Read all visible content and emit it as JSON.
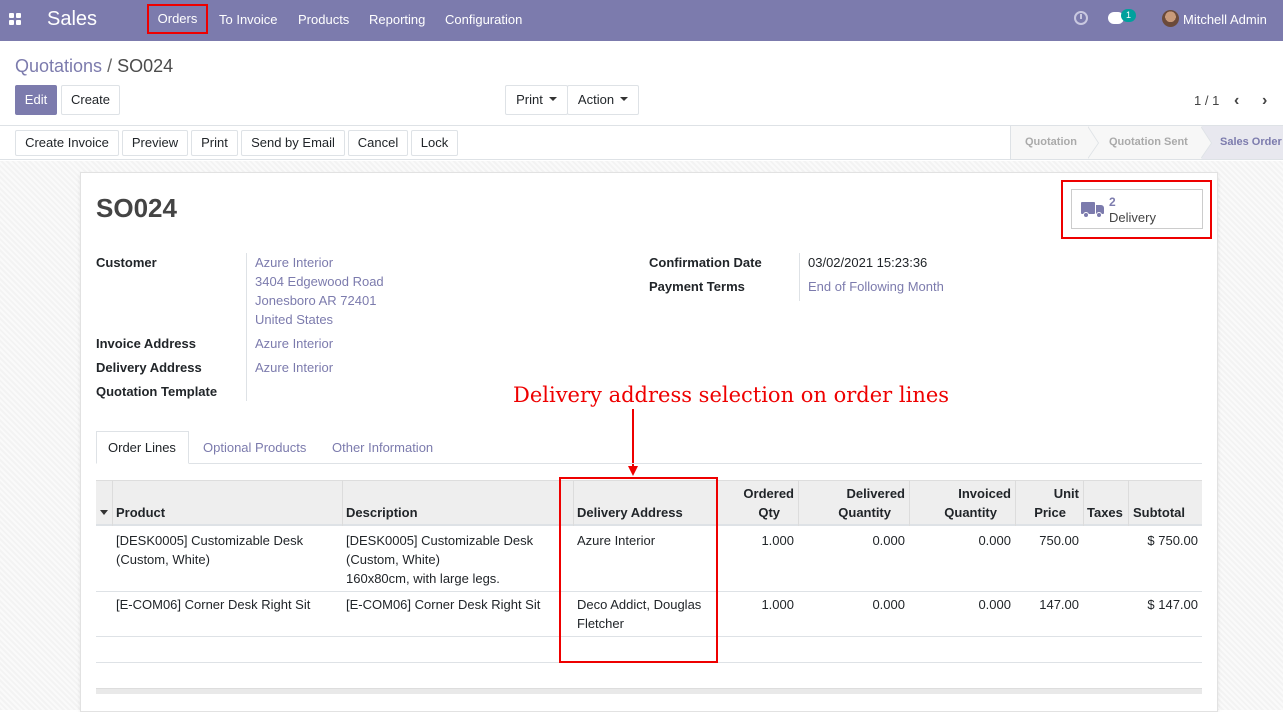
{
  "navbar": {
    "app_name": "Sales",
    "menu": [
      "Orders",
      "To Invoice",
      "Products",
      "Reporting",
      "Configuration"
    ],
    "notification_count": "1",
    "user_name": "Mitchell Admin"
  },
  "breadcrumb": {
    "parent": "Quotations",
    "separator": "/",
    "current": "SO024"
  },
  "control": {
    "edit_label": "Edit",
    "create_label": "Create",
    "print_label": "Print",
    "action_label": "Action",
    "pager": "1 / 1"
  },
  "statusbar": {
    "buttons": [
      "Create Invoice",
      "Preview",
      "Print",
      "Send by Email",
      "Cancel",
      "Lock"
    ],
    "stages": [
      "Quotation",
      "Quotation Sent",
      "Sales Order"
    ],
    "active_stage": "Sales Order"
  },
  "record": {
    "name": "SO024",
    "smart_button": {
      "count": "2",
      "label": "Delivery",
      "icon": "truck-icon"
    },
    "fields_left": {
      "customer_label": "Customer",
      "customer_lines": [
        "Azure Interior",
        "3404 Edgewood Road",
        "Jonesboro AR 72401",
        "United States"
      ],
      "invoice_address_label": "Invoice Address",
      "invoice_address": "Azure Interior",
      "delivery_address_label": "Delivery Address",
      "delivery_address": "Azure Interior",
      "quotation_template_label": "Quotation Template",
      "quotation_template": ""
    },
    "fields_right": {
      "confirmation_date_label": "Confirmation Date",
      "confirmation_date": "03/02/2021 15:23:36",
      "payment_terms_label": "Payment Terms",
      "payment_terms": "End of Following Month"
    }
  },
  "annotation": "Delivery address selection on order lines",
  "tabs": [
    "Order Lines",
    "Optional Products",
    "Other Information"
  ],
  "order_lines": {
    "headers": {
      "product": "Product",
      "description": "Description",
      "delivery_address": "Delivery Address",
      "ordered_qty_1": "Ordered",
      "ordered_qty_2": "Qty",
      "delivered_qty_1": "Delivered",
      "delivered_qty_2": "Quantity",
      "invoiced_qty_1": "Invoiced",
      "invoiced_qty_2": "Quantity",
      "unit_price_1": "Unit",
      "unit_price_2": "Price",
      "taxes": "Taxes",
      "subtotal": "Subtotal"
    },
    "rows": [
      {
        "product_1": "[DESK0005] Customizable Desk",
        "product_2": "(Custom, White)",
        "description_1": "[DESK0005] Customizable Desk",
        "description_2": "(Custom, White)",
        "description_3": "160x80cm, with large legs.",
        "delivery_address_1": "Azure Interior",
        "delivery_address_2": "",
        "ordered_qty": "1.000",
        "delivered_qty": "0.000",
        "invoiced_qty": "0.000",
        "unit_price": "750.00",
        "taxes": "",
        "subtotal": "$ 750.00"
      },
      {
        "product_1": "[E-COM06] Corner Desk Right Sit",
        "product_2": "",
        "description_1": "[E-COM06] Corner Desk Right Sit",
        "description_2": "",
        "description_3": "",
        "delivery_address_1": "Deco Addict, Douglas",
        "delivery_address_2": "Fletcher",
        "ordered_qty": "1.000",
        "delivered_qty": "0.000",
        "invoiced_qty": "0.000",
        "unit_price": "147.00",
        "taxes": "",
        "subtotal": "$ 147.00"
      }
    ]
  },
  "colors": {
    "brand": "#7c7bad",
    "highlight": "#e00000",
    "badge": "#00a09d"
  }
}
